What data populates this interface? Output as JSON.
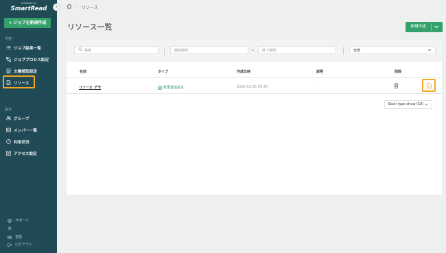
{
  "sidebar": {
    "logo_small": "COGENT AI",
    "logo": "SmartRead",
    "new_job_label": "+ ジョブを新規作成",
    "section_main": "内容",
    "main_items": [
      {
        "label": "ジョブ結果一覧",
        "icon": "list-check-icon"
      },
      {
        "label": "ジョブプロセス設定",
        "icon": "nodes-icon"
      },
      {
        "label": "文書読取設定",
        "icon": "document-icon"
      },
      {
        "label": "リソース",
        "icon": "resource-icon",
        "active": true
      }
    ],
    "section_settings": "設定",
    "settings_items": [
      {
        "label": "グループ",
        "icon": "group-icon"
      },
      {
        "label": "メンバー一覧",
        "icon": "member-card-icon"
      },
      {
        "label": "利用状況",
        "icon": "usage-gauge-icon"
      },
      {
        "label": "アクセス設定",
        "icon": "access-icon"
      }
    ],
    "footer_items": [
      {
        "label": "サポート",
        "icon": "help-icon"
      },
      {
        "label": "",
        "icon": "gear-icon"
      },
      {
        "label": "言語",
        "icon": "language-icon"
      },
      {
        "label": "ログアウト",
        "icon": "logout-icon"
      }
    ]
  },
  "breadcrumb": {
    "current": "リソース"
  },
  "page": {
    "title": "リソース一覧",
    "create_label": "新規作成"
  },
  "filters": {
    "search_placeholder": "検索",
    "start_placeholder": "開始時刻",
    "range_sep": "~",
    "end_placeholder": "終了時刻",
    "type_value": "全部"
  },
  "table": {
    "headers": {
      "name": "名前",
      "type": "タイプ",
      "created": "作成日時",
      "description": "説明",
      "delete": "削除"
    },
    "rows": [
      {
        "name": "リソース_デモ",
        "type": "辞書置換設定",
        "created": "2026-02-25 09:30",
        "description": "-"
      }
    ]
  },
  "pagination": {
    "page_size_label": "Each type show (10)"
  },
  "colors": {
    "accent": "#34a06a",
    "sidebar": "#1f4a56",
    "highlight": "#f5a623"
  }
}
